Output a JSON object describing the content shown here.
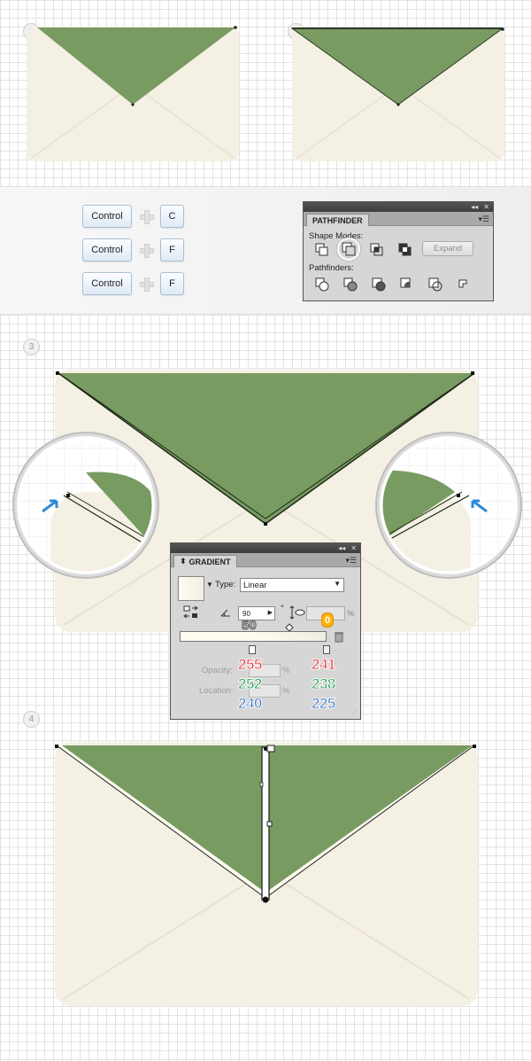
{
  "steps": [
    "1",
    "2",
    "3",
    "4"
  ],
  "colors": {
    "envelope_fill": "#f4f0e4",
    "envelope_fold": "#e9e3d2",
    "flap_green": "#789b62",
    "flap_stroke": "#2e3a25"
  },
  "shortcuts": [
    {
      "modifier": "Control",
      "key": "C"
    },
    {
      "modifier": "Control",
      "key": "F"
    },
    {
      "modifier": "Control",
      "key": "F"
    }
  ],
  "pathfinder": {
    "title": "PATHFINDER",
    "shape_modes_label": "Shape Modes:",
    "pathfinders_label": "Pathfinders:",
    "expand_label": "Expand",
    "shape_mode_icons": [
      "unite-icon",
      "minus-front-icon",
      "intersect-icon",
      "exclude-icon"
    ],
    "pathfinder_icons": [
      "divide-icon",
      "trim-icon",
      "merge-icon",
      "crop-icon",
      "outline-icon",
      "minus-back-icon"
    ]
  },
  "gradient": {
    "title": "GRADIENT",
    "type_label": "Type:",
    "type_value": "Linear",
    "angle_value": "90",
    "angle_unit": "°",
    "angle_overlay": "50",
    "aspect_badge": "0",
    "percent": "%",
    "opacity_label": "Opacity:",
    "location_label": "Location:",
    "stop_left": {
      "r": "255",
      "g": "252",
      "b": "240"
    },
    "stop_right": {
      "r": "241",
      "g": "238",
      "b": "225"
    }
  }
}
